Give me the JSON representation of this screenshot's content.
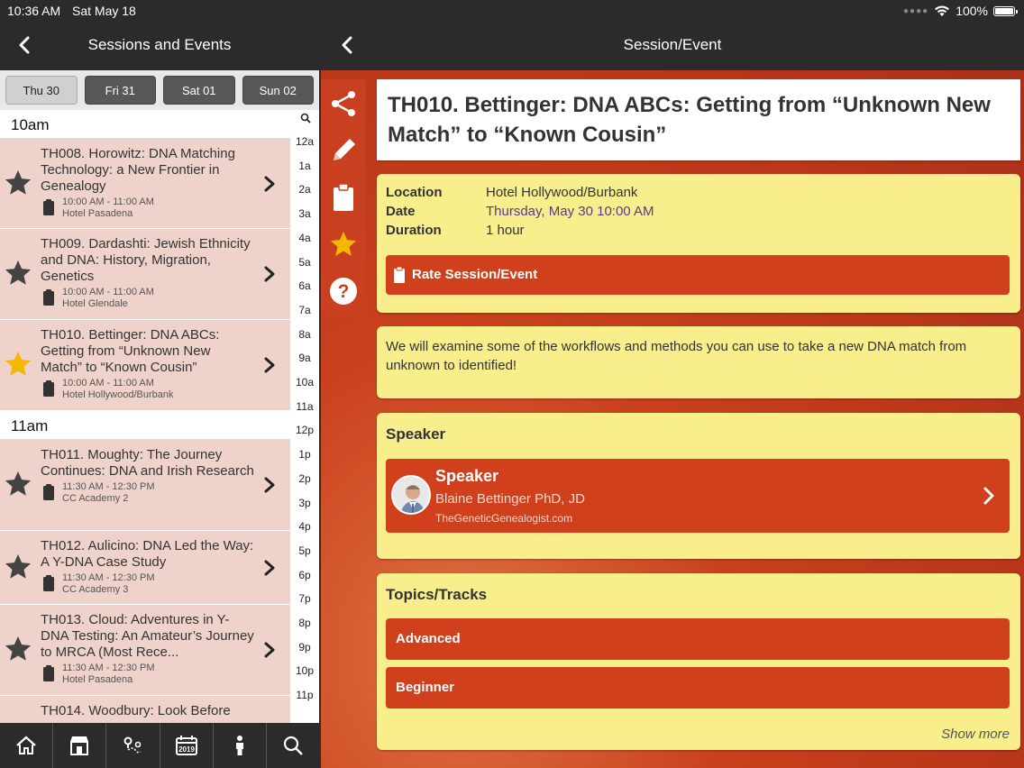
{
  "status_bar": {
    "time": "10:36 AM",
    "date": "Sat May 18",
    "battery": "100%",
    "icons": [
      "wifi-icon",
      "battery-icon"
    ]
  },
  "left": {
    "header_title": "Sessions and Events",
    "day_tabs": [
      {
        "label": "Thu 30",
        "active": true
      },
      {
        "label": "Fri 31",
        "active": false
      },
      {
        "label": "Sat 01",
        "active": false
      },
      {
        "label": "Sun 02",
        "active": false
      }
    ],
    "hours": [
      {
        "label": "10am",
        "sessions": [
          {
            "title": "TH008. Horowitz: DNA Matching Technology: a New Frontier in Genealogy",
            "time": "10:00 AM - 11:00 AM",
            "location": "Hotel Pasadena",
            "starred": false
          },
          {
            "title": "TH009. Dardashti: Jewish Ethnicity and DNA: History, Migration, Genetics",
            "time": "10:00 AM - 11:00 AM",
            "location": "Hotel Glendale",
            "starred": false
          },
          {
            "title": "TH010. Bettinger: DNA ABCs: Getting from “Unknown New Match” to “Known Cousin”",
            "time": "10:00 AM - 11:00 AM",
            "location": "Hotel Hollywood/Burbank",
            "starred": true
          }
        ]
      },
      {
        "label": "11am",
        "sessions": [
          {
            "title": "TH011. Moughty: The Journey Continues: DNA and Irish Research",
            "time": "11:30 AM - 12:30 PM",
            "location": "CC Academy 2",
            "starred": false
          },
          {
            "title": "TH012. Aulicino: DNA Led the Way: A Y-DNA Case Study",
            "time": "11:30 AM - 12:30 PM",
            "location": "CC Academy 3",
            "starred": false
          },
          {
            "title": "TH013. Cloud: Adventures in Y-DNA Testing: An Amateur’s Journey to MRCA (Most Rece...",
            "time": "11:30 AM - 12:30 PM",
            "location": "Hotel Pasadena",
            "starred": false
          },
          {
            "title": "TH014. Woodbury: Look Before",
            "time": "",
            "location": "",
            "starred": false
          }
        ]
      }
    ],
    "time_index": [
      "12a",
      "1a",
      "2a",
      "3a",
      "4a",
      "5a",
      "6a",
      "7a",
      "8a",
      "9a",
      "10a",
      "11a",
      "12p",
      "1p",
      "2p",
      "3p",
      "4p",
      "5p",
      "6p",
      "7p",
      "8p",
      "9p",
      "10p",
      "11p"
    ],
    "tab_bar": [
      "home-icon",
      "exhibitor-icon",
      "map-icon",
      "calendar-icon",
      "person-icon",
      "search-icon"
    ],
    "calendar_year": "2019"
  },
  "right": {
    "header_title": "Session/Event",
    "title": "TH010. Bettinger: DNA ABCs: Getting from “Unknown New Match” to “Known Cousin”",
    "details": {
      "location_label": "Location",
      "location": "Hotel Hollywood/Burbank",
      "date_label": "Date",
      "date": "Thursday, May 30 10:00 AM",
      "duration_label": "Duration",
      "duration": "1 hour"
    },
    "rate_button": "Rate Session/Event",
    "description": "We will examine some of the workflows and methods you can use to take a new DNA match from unknown to identified!",
    "speaker_section": "Speaker",
    "speaker": {
      "label": "Speaker",
      "name": "Blaine Bettinger PhD, JD",
      "site": "TheGeneticGenealogist.com"
    },
    "topics_section": "Topics/Tracks",
    "topics": [
      "Advanced",
      "Beginner"
    ],
    "show_more": "Show more",
    "actions": [
      "share-icon",
      "pencil-icon",
      "clipboard-icon",
      "star-icon",
      "help-icon"
    ]
  },
  "colors": {
    "accent_red": "#d0401c",
    "card_yellow": "#f8ee8c",
    "session_pink": "#efd3cb",
    "star_gold": "#f5b800",
    "dark_bar": "#2b2b2b"
  }
}
